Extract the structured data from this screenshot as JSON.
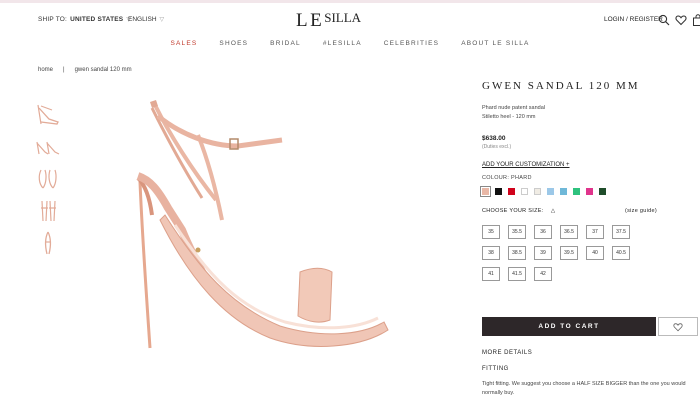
{
  "header": {
    "ship_label": "SHIP TO:",
    "ship_value": "UNITED STATES",
    "language": "ENGLISH",
    "logo_main": "LE",
    "logo_rest": "SILLA",
    "login": "LOGIN / REGISTER",
    "icons": [
      "search-icon",
      "heart-icon",
      "bag-icon"
    ]
  },
  "nav": {
    "items": [
      "SALES",
      "SHOES",
      "BRIDAL",
      "#LESILLA",
      "CELEBRITIES",
      "ABOUT LE SILLA"
    ],
    "accent": "#c0392b"
  },
  "breadcrumb": {
    "home": "home",
    "sep": "|",
    "current": "gwen sandal 120 mm"
  },
  "product": {
    "title": "GWEN SANDAL 120 MM",
    "desc1": "Phard nude patent sandal",
    "desc2": "Stiletto heel - 120 mm",
    "price": "$638.00",
    "duties": "(Duties excl.)",
    "customize": "ADD YOUR CUSTOMIZATION +",
    "colour_label": "COLOUR: PHARD",
    "swatches": [
      "#e8b7a6",
      "#111111",
      "#d0021b",
      "#ffffff",
      "#f0ece4",
      "#9cc8e8",
      "#6fb8d8",
      "#2ec27e",
      "#e0348c",
      "#1f4d2a"
    ],
    "size_label": "CHOOSE YOUR SIZE:",
    "size_guide": "(size guide)",
    "sizes": [
      "35",
      "35.5",
      "36",
      "36.5",
      "37",
      "37.5",
      "38",
      "38.5",
      "39",
      "39.5",
      "40",
      "40.5",
      "41",
      "41.5",
      "42"
    ],
    "add_to_cart": "ADD TO CART",
    "more_details": "MORE DETAILS",
    "fitting": "FITTING",
    "fitting_text": "Tight fitting. We suggest you choose a HALF SIZE BIGGER than the one you would normally buy."
  }
}
